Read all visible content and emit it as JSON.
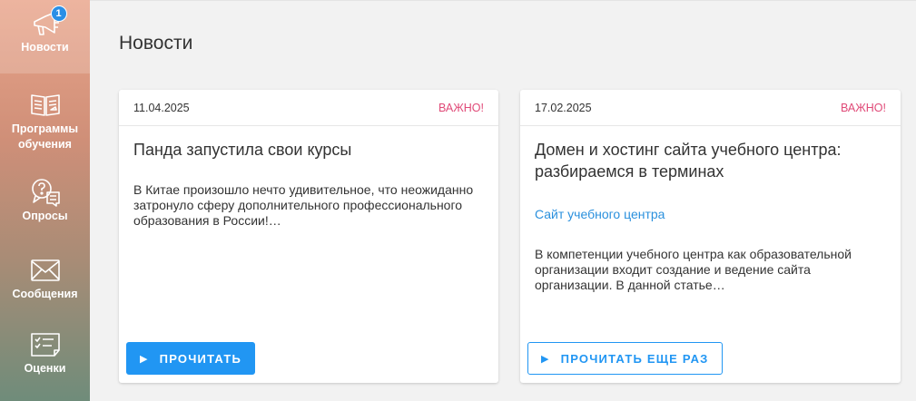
{
  "sidebar": {
    "items": [
      {
        "label": "Новости",
        "icon": "megaphone-icon",
        "badge": "1",
        "active": true
      },
      {
        "label": "Программы обучения",
        "icon": "open-book-icon"
      },
      {
        "label": "Опросы",
        "icon": "chat-question-icon"
      },
      {
        "label": "Сообщения",
        "icon": "envelope-icon"
      },
      {
        "label": "Оценки",
        "icon": "checklist-icon"
      }
    ]
  },
  "page": {
    "title": "Новости"
  },
  "news": [
    {
      "date": "11.04.2025",
      "flag": "ВАЖНО!",
      "title": "Панда запустила свои курсы",
      "link": "",
      "excerpt": "В Китае произошло нечто удивительное, что неожиданно затронуло сферу дополнительного профессионального образования в России!…",
      "button": "ПРОЧИТАТЬ"
    },
    {
      "date": "17.02.2025",
      "flag": "ВАЖНО!",
      "title": "Домен и хостинг сайта учебного центра: разбираемся в терминах",
      "link": "Сайт учебного центра",
      "excerpt": "В компетенции учебного центра как образовательной организации входит создание и ведение сайта организации. В данной статье…",
      "button": "ПРОЧИТАТЬ ЕЩЕ РАЗ"
    }
  ],
  "colors": {
    "accent": "#2196f3",
    "flag": "#e04a78",
    "link": "#2a90dd"
  }
}
